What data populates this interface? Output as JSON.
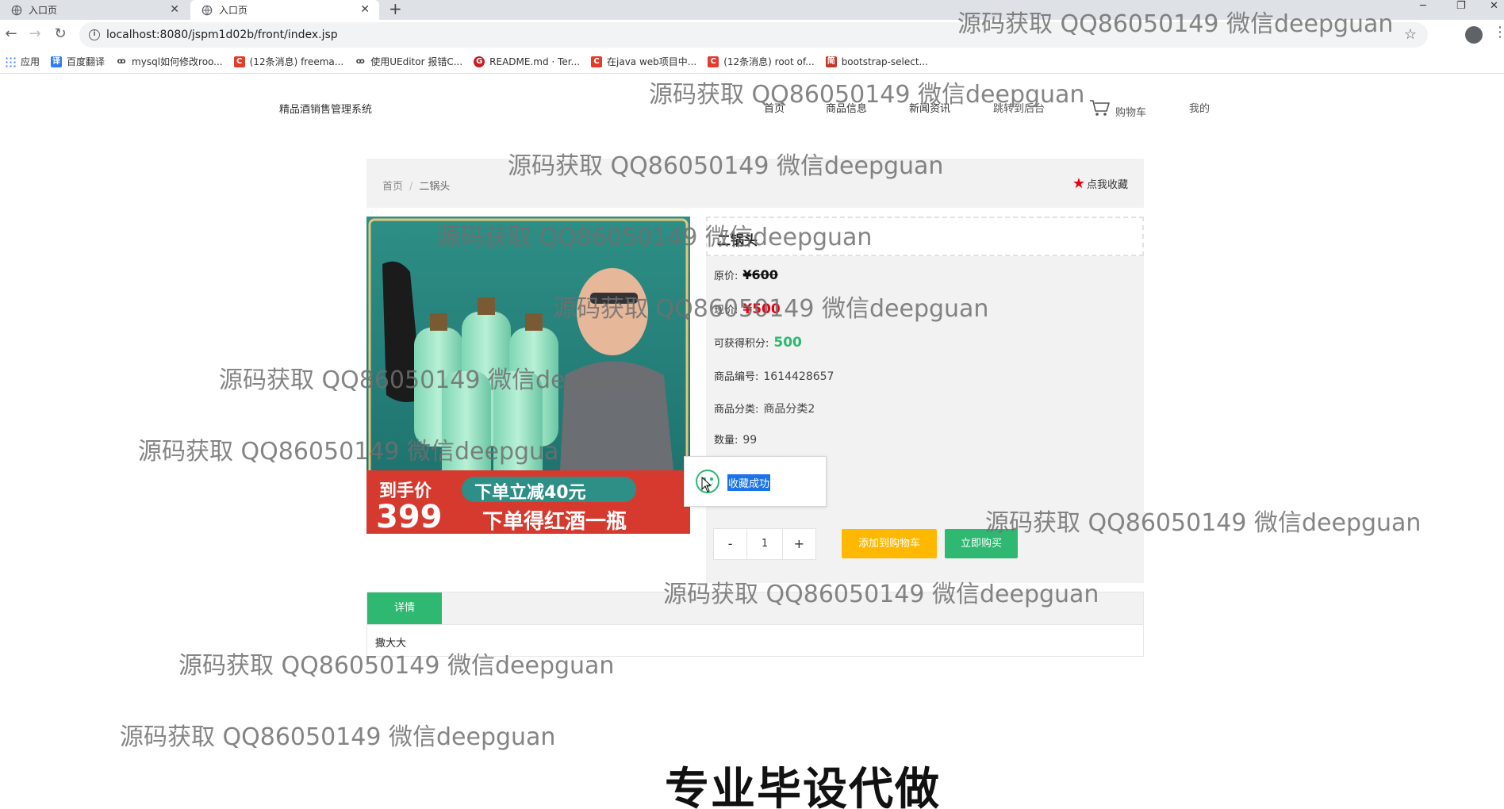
{
  "browser": {
    "tabs": [
      {
        "title": "入口页",
        "active": false
      },
      {
        "title": "入口页",
        "active": true
      }
    ],
    "url": "localhost:8080/jspm1d02b/front/index.jsp",
    "bookmarks": [
      {
        "label": "应用",
        "icon": "apps-grid-icon",
        "color": "#4285f4"
      },
      {
        "label": "百度翻译",
        "icon": "baidu-translate-icon",
        "color": "#2e7ef0"
      },
      {
        "label": "mysql如何修改roo...",
        "icon": "link-icon",
        "color": "#444444"
      },
      {
        "label": "(12条消息) freema...",
        "icon": "csdn-icon",
        "color": "#e53b2c"
      },
      {
        "label": "使用UEditor 报错C...",
        "icon": "link-icon",
        "color": "#444444"
      },
      {
        "label": "README.md · Ter...",
        "icon": "gitee-icon",
        "color": "#c71d23"
      },
      {
        "label": "在java web项目中...",
        "icon": "csdn-icon",
        "color": "#e53b2c"
      },
      {
        "label": "(12条消息) root of...",
        "icon": "csdn-icon",
        "color": "#e53b2c"
      },
      {
        "label": "bootstrap-select...",
        "icon": "blog-icon",
        "color": "#c0392b"
      }
    ]
  },
  "site": {
    "title": "精品酒销售管理系统",
    "nav": [
      "首页",
      "商品信息",
      "新闻资讯",
      "跳转到后台",
      "购物车",
      "我的"
    ]
  },
  "breadcrumb": {
    "home": "首页",
    "separator": "/",
    "current": "二锅头"
  },
  "favorite_label": "点我收藏",
  "product": {
    "name": "二锅头",
    "original_price_label": "原价:",
    "original_price": "¥600",
    "current_price_label": "现价:",
    "current_price": "¥500",
    "points_label": "可获得积分:",
    "points": "500",
    "code_label": "商品编号:",
    "code": "1614428657",
    "category_label": "商品分类:",
    "category": "商品分类2",
    "stock_label": "数量:",
    "stock": "99",
    "quantity": "1"
  },
  "image_promo": {
    "price_label": "到手价",
    "price": "399",
    "offer1": "下单立减40元",
    "offer2": "下单得红酒一瓶"
  },
  "buttons": {
    "minus": "-",
    "plus": "+",
    "add_to_cart": "添加到购物车",
    "buy_now": "立即购买"
  },
  "toast": {
    "message": "收藏成功"
  },
  "detail": {
    "tab_label": "详情",
    "content": "撒大大"
  },
  "watermark": "源码获取 QQ86050149 微信deepguan",
  "caption": "专业毕设代做",
  "colors": {
    "accent_green": "#2eb872",
    "cart_yellow": "#ffb800",
    "price_red": "#e60012"
  }
}
